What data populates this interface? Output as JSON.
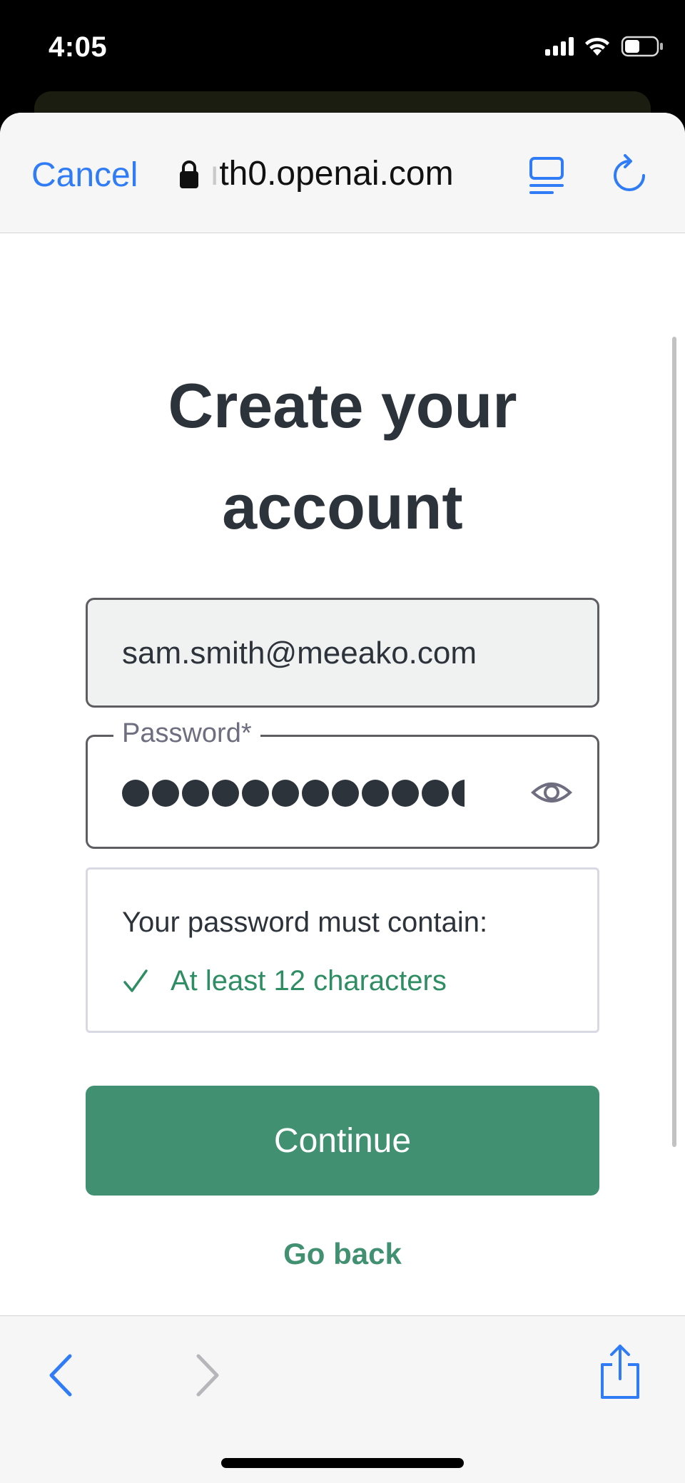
{
  "status_bar": {
    "time": "4:05",
    "icons": [
      "signal-icon",
      "wifi-icon",
      "battery-icon"
    ]
  },
  "nav": {
    "cancel_label": "Cancel",
    "url_faded": "ı",
    "url": "th0.openai.com",
    "icons": [
      "lock-icon",
      "reader-mode-icon",
      "reload-icon"
    ]
  },
  "form": {
    "title": "Create your account",
    "email_value": "sam.smith@meeako.com",
    "password_label": "Password*",
    "password_length": 12,
    "requirements_title": "Your password must contain:",
    "requirement_text": "At least 12 characters",
    "continue_label": "Continue",
    "go_back_label": "Go back"
  },
  "toolbar": {
    "icons": [
      "back-icon",
      "forward-icon",
      "share-icon"
    ]
  },
  "colors": {
    "accent_blue": "#2f7cf6",
    "brand_green": "#429072",
    "check_green": "#2e8d63",
    "text_dark": "#2d333a"
  }
}
